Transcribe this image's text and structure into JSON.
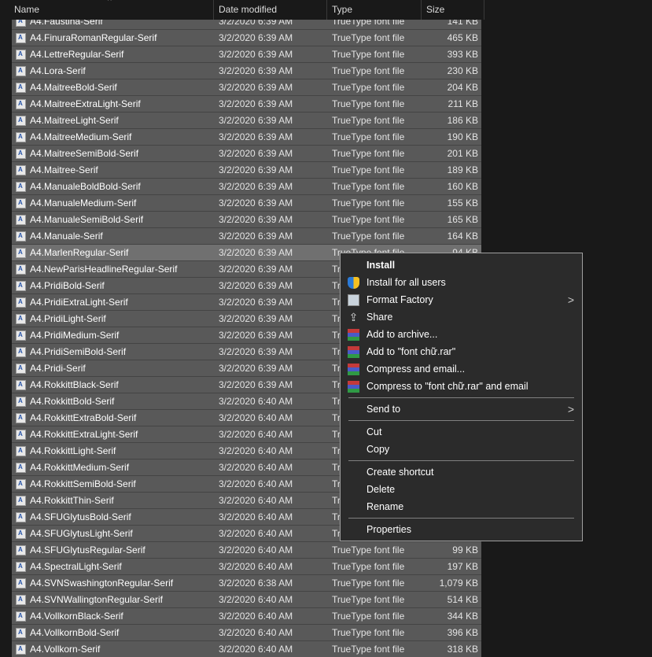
{
  "columns": {
    "name": "Name",
    "date": "Date modified",
    "type": "Type",
    "size": "Size"
  },
  "colors": {
    "selected_row": "#595959",
    "focused_row": "#707070",
    "menu_bg": "#2b2b2b",
    "background": "#191919"
  },
  "files": [
    {
      "name": "A4.Faustina-Serif",
      "date": "3/2/2020 6:39 AM",
      "type": "TrueType font file",
      "size": "141 KB"
    },
    {
      "name": "A4.FinuraRomanRegular-Serif",
      "date": "3/2/2020 6:39 AM",
      "type": "TrueType font file",
      "size": "465 KB"
    },
    {
      "name": "A4.LettreRegular-Serif",
      "date": "3/2/2020 6:39 AM",
      "type": "TrueType font file",
      "size": "393 KB"
    },
    {
      "name": "A4.Lora-Serif",
      "date": "3/2/2020 6:39 AM",
      "type": "TrueType font file",
      "size": "230 KB"
    },
    {
      "name": "A4.MaitreeBold-Serif",
      "date": "3/2/2020 6:39 AM",
      "type": "TrueType font file",
      "size": "204 KB"
    },
    {
      "name": "A4.MaitreeExtraLight-Serif",
      "date": "3/2/2020 6:39 AM",
      "type": "TrueType font file",
      "size": "211 KB"
    },
    {
      "name": "A4.MaitreeLight-Serif",
      "date": "3/2/2020 6:39 AM",
      "type": "TrueType font file",
      "size": "186 KB"
    },
    {
      "name": "A4.MaitreeMedium-Serif",
      "date": "3/2/2020 6:39 AM",
      "type": "TrueType font file",
      "size": "190 KB"
    },
    {
      "name": "A4.MaitreeSemiBold-Serif",
      "date": "3/2/2020 6:39 AM",
      "type": "TrueType font file",
      "size": "201 KB"
    },
    {
      "name": "A4.Maitree-Serif",
      "date": "3/2/2020 6:39 AM",
      "type": "TrueType font file",
      "size": "189 KB"
    },
    {
      "name": "A4.ManualeBoldBold-Serif",
      "date": "3/2/2020 6:39 AM",
      "type": "TrueType font file",
      "size": "160 KB"
    },
    {
      "name": "A4.ManualeMedium-Serif",
      "date": "3/2/2020 6:39 AM",
      "type": "TrueType font file",
      "size": "155 KB"
    },
    {
      "name": "A4.ManualeSemiBold-Serif",
      "date": "3/2/2020 6:39 AM",
      "type": "TrueType font file",
      "size": "165 KB"
    },
    {
      "name": "A4.Manuale-Serif",
      "date": "3/2/2020 6:39 AM",
      "type": "TrueType font file",
      "size": "164 KB"
    },
    {
      "name": "A4.MarlenRegular-Serif",
      "date": "3/2/2020 6:39 AM",
      "type": "TrueType font file",
      "size": "94 KB"
    },
    {
      "name": "A4.NewParisHeadlineRegular-Serif",
      "date": "3/2/2020 6:39 AM",
      "type": "TrueType font file",
      "size": ""
    },
    {
      "name": "A4.PridiBold-Serif",
      "date": "3/2/2020 6:39 AM",
      "type": "TrueType font file",
      "size": ""
    },
    {
      "name": "A4.PridiExtraLight-Serif",
      "date": "3/2/2020 6:39 AM",
      "type": "TrueType font file",
      "size": ""
    },
    {
      "name": "A4.PridiLight-Serif",
      "date": "3/2/2020 6:39 AM",
      "type": "TrueType font file",
      "size": ""
    },
    {
      "name": "A4.PridiMedium-Serif",
      "date": "3/2/2020 6:39 AM",
      "type": "TrueType font file",
      "size": ""
    },
    {
      "name": "A4.PridiSemiBold-Serif",
      "date": "3/2/2020 6:39 AM",
      "type": "TrueType font file",
      "size": ""
    },
    {
      "name": "A4.Pridi-Serif",
      "date": "3/2/2020 6:39 AM",
      "type": "TrueType font file",
      "size": ""
    },
    {
      "name": "A4.RokkittBlack-Serif",
      "date": "3/2/2020 6:39 AM",
      "type": "TrueType font file",
      "size": ""
    },
    {
      "name": "A4.RokkittBold-Serif",
      "date": "3/2/2020 6:40 AM",
      "type": "TrueType font file",
      "size": ""
    },
    {
      "name": "A4.RokkittExtraBold-Serif",
      "date": "3/2/2020 6:40 AM",
      "type": "TrueType font file",
      "size": ""
    },
    {
      "name": "A4.RokkittExtraLight-Serif",
      "date": "3/2/2020 6:40 AM",
      "type": "TrueType font file",
      "size": ""
    },
    {
      "name": "A4.RokkittLight-Serif",
      "date": "3/2/2020 6:40 AM",
      "type": "TrueType font file",
      "size": ""
    },
    {
      "name": "A4.RokkittMedium-Serif",
      "date": "3/2/2020 6:40 AM",
      "type": "TrueType font file",
      "size": ""
    },
    {
      "name": "A4.RokkittSemiBold-Serif",
      "date": "3/2/2020 6:40 AM",
      "type": "TrueType font file",
      "size": ""
    },
    {
      "name": "A4.RokkittThin-Serif",
      "date": "3/2/2020 6:40 AM",
      "type": "TrueType font file",
      "size": ""
    },
    {
      "name": "A4.SFUGlytusBold-Serif",
      "date": "3/2/2020 6:40 AM",
      "type": "TrueType font file",
      "size": ""
    },
    {
      "name": "A4.SFUGlytusLight-Serif",
      "date": "3/2/2020 6:40 AM",
      "type": "TrueType font file",
      "size": ""
    },
    {
      "name": "A4.SFUGlytusRegular-Serif",
      "date": "3/2/2020 6:40 AM",
      "type": "TrueType font file",
      "size": "99 KB"
    },
    {
      "name": "A4.SpectralLight-Serif",
      "date": "3/2/2020 6:40 AM",
      "type": "TrueType font file",
      "size": "197 KB"
    },
    {
      "name": "A4.SVNSwashingtonRegular-Serif",
      "date": "3/2/2020 6:38 AM",
      "type": "TrueType font file",
      "size": "1,079 KB"
    },
    {
      "name": "A4.SVNWallingtonRegular-Serif",
      "date": "3/2/2020 6:40 AM",
      "type": "TrueType font file",
      "size": "514 KB"
    },
    {
      "name": "A4.VollkornBlack-Serif",
      "date": "3/2/2020 6:40 AM",
      "type": "TrueType font file",
      "size": "344 KB"
    },
    {
      "name": "A4.VollkornBold-Serif",
      "date": "3/2/2020 6:40 AM",
      "type": "TrueType font file",
      "size": "396 KB"
    },
    {
      "name": "A4.Vollkorn-Serif",
      "date": "3/2/2020 6:40 AM",
      "type": "TrueType font file",
      "size": "318 KB"
    }
  ],
  "focused_index": 14,
  "context_menu": [
    {
      "label": "Install",
      "icon": "",
      "bold": true
    },
    {
      "label": "Install for all users",
      "icon": "shield-icon"
    },
    {
      "label": "Format Factory",
      "icon": "format-factory-icon",
      "submenu": true
    },
    {
      "label": "Share",
      "icon": "share-icon"
    },
    {
      "label": "Add to archive...",
      "icon": "winrar-icon"
    },
    {
      "label": "Add to \"font chữ.rar\"",
      "icon": "winrar-icon"
    },
    {
      "label": "Compress and email...",
      "icon": "winrar-icon"
    },
    {
      "label": "Compress to \"font chữ.rar\" and email",
      "icon": "winrar-icon"
    },
    {
      "sep": true
    },
    {
      "label": "Send to",
      "submenu": true
    },
    {
      "sep": true
    },
    {
      "label": "Cut"
    },
    {
      "label": "Copy"
    },
    {
      "sep": true
    },
    {
      "label": "Create shortcut"
    },
    {
      "label": "Delete"
    },
    {
      "label": "Rename"
    },
    {
      "sep": true
    },
    {
      "label": "Properties"
    }
  ]
}
